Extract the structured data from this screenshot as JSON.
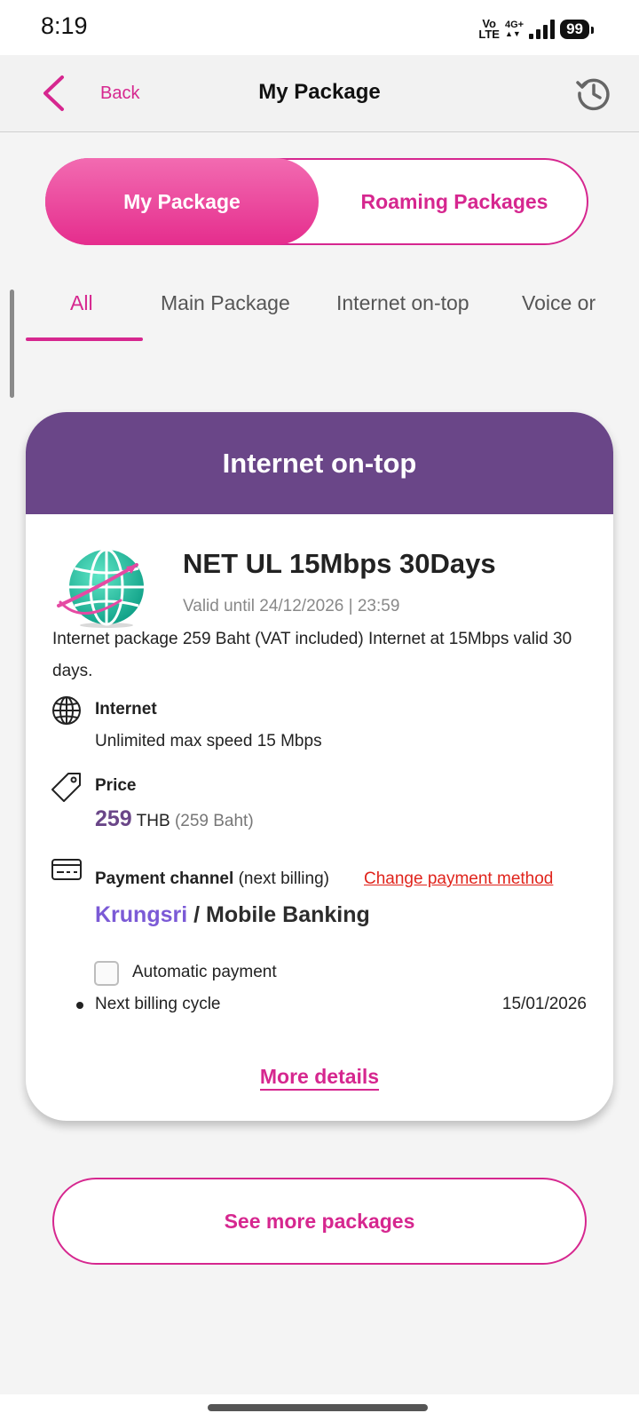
{
  "status_bar": {
    "time": "8:19",
    "volte_line1": "Vo",
    "volte_line2": "LTE",
    "network": "4G+",
    "battery": "99"
  },
  "header": {
    "back_label": "Back",
    "title": "My Package",
    "history_icon": "history-icon"
  },
  "segment": {
    "active": "My Package",
    "inactive": "Roaming Packages"
  },
  "tabs": [
    "All",
    "Main Package",
    "Internet on-top",
    "Voice or"
  ],
  "active_tab": "All",
  "package": {
    "category": "Internet on-top",
    "name": "NET UL 15Mbps 30Days",
    "valid": "Valid until 24/12/2026 | 23:59",
    "description": "Internet package 259 Baht (VAT included) Internet at 15Mbps valid 30 days.",
    "internet_label": "Internet",
    "internet_value": "Unlimited max speed 15 Mbps",
    "price_label": "Price",
    "price_amount": "259",
    "price_currency": "THB",
    "price_note": "(259 Baht)",
    "payment_label": "Payment channel",
    "payment_suffix": "(next billing)",
    "change_payment": "Change payment method",
    "bank": "Krungsri",
    "bank_channel": "/ Mobile Banking",
    "auto_payment_label": "Automatic payment",
    "auto_payment_checked": false,
    "next_billing_label": "Next billing cycle",
    "next_billing_date": "15/01/2026",
    "more_details": "More details"
  },
  "see_more": "See more packages",
  "colors": {
    "accent": "#d6278f",
    "card_header": "#6a4688",
    "bank": "#7b5ad6",
    "link_red": "#e0241c"
  }
}
